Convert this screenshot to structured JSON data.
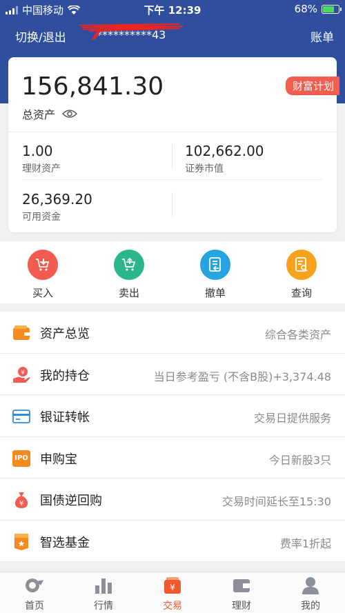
{
  "status_bar": {
    "carrier": "中国移动",
    "time": "下午 12:39",
    "battery": "68%",
    "battery_level": 0.68
  },
  "header": {
    "switch_label": "切换/退出",
    "account_masked": "**********43",
    "bill_label": "账单"
  },
  "assets": {
    "total_value": "156,841.30",
    "total_label": "总资产",
    "wealth_plan_tag": "财富计划",
    "items": [
      {
        "value": "1.00",
        "label": "理财资产"
      },
      {
        "value": "102,662.00",
        "label": "证券市值"
      },
      {
        "value": "26,369.20",
        "label": "可用资金"
      }
    ]
  },
  "actions": [
    {
      "label": "买入",
      "icon": "cart-in-icon",
      "color": "#f25b4f"
    },
    {
      "label": "卖出",
      "icon": "cart-out-icon",
      "color": "#2bb58b"
    },
    {
      "label": "撤单",
      "icon": "cancel-order-icon",
      "color": "#26a3e0"
    },
    {
      "label": "查询",
      "icon": "query-doc-icon",
      "color": "#f7a21d"
    }
  ],
  "menu": [
    {
      "title": "资产总览",
      "desc": "综合各类资产",
      "icon": "wallet-icon"
    },
    {
      "title": "我的持仓",
      "desc": "当日参考盈亏 (不含B股)+3,374.48",
      "icon": "hand-coin-icon"
    },
    {
      "title": "银证转帐",
      "desc": "交易日提供服务",
      "icon": "bank-card-icon"
    },
    {
      "title": "申购宝",
      "desc": "今日新股3只",
      "icon": "ipo-icon",
      "icon_text": "IPO"
    },
    {
      "title": "国债逆回购",
      "desc": "交易时间延长至15:30",
      "icon": "money-bag-icon"
    },
    {
      "title": "智选基金",
      "desc": "费率1折起",
      "icon": "fund-badge-icon"
    }
  ],
  "tabs": [
    {
      "label": "首页",
      "icon": "home-icon",
      "active": false
    },
    {
      "label": "行情",
      "icon": "bar-chart-icon",
      "active": false
    },
    {
      "label": "交易",
      "icon": "trade-icon",
      "active": true
    },
    {
      "label": "理财",
      "icon": "wallet-icon",
      "active": false
    },
    {
      "label": "我的",
      "icon": "user-icon",
      "active": false
    }
  ],
  "colors": {
    "header_bg": "#2f4f9e",
    "accent_red": "#f15d4f",
    "tab_active": "#f15a2b"
  }
}
